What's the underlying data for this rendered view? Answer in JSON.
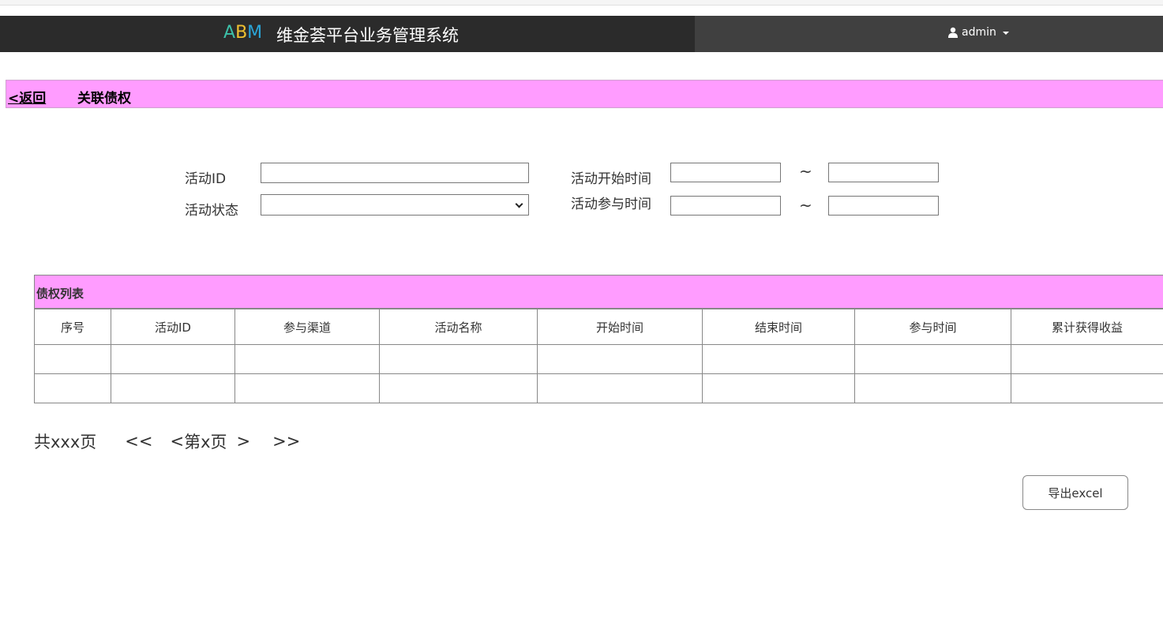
{
  "header": {
    "logo": {
      "a": "A",
      "b": "B",
      "m": "M"
    },
    "title": "维金荟平台业务管理系统",
    "user": "admin",
    "logo_colors": {
      "a": "#3cc0a8",
      "b": "#f0c030",
      "m": "#2aa5d8"
    }
  },
  "bar": {
    "back": "<返回",
    "title": "关联债权",
    "color": "#ff9cff"
  },
  "filters": {
    "activity_id_label": "活动ID",
    "activity_id_value": "",
    "status_label": "活动状态",
    "status_value": "",
    "start_time_label": "活动开始时间",
    "join_time_label": "活动参与时间",
    "range_sep": "~"
  },
  "table": {
    "title": "债权列表",
    "columns": [
      "序号",
      "活动ID",
      "参与渠道",
      "活动名称",
      "开始时间",
      "结束时间",
      "参与时间",
      "累计获得收益"
    ],
    "rows": [
      [
        "",
        "",
        "",
        "",
        "",
        "",
        "",
        ""
      ],
      [
        "",
        "",
        "",
        "",
        "",
        "",
        "",
        ""
      ]
    ]
  },
  "pager": {
    "total": "共xxx页",
    "first": "<<",
    "prev": "<",
    "current": "第x页",
    "next": ">",
    "last": ">>"
  },
  "actions": {
    "export": "导出excel"
  }
}
